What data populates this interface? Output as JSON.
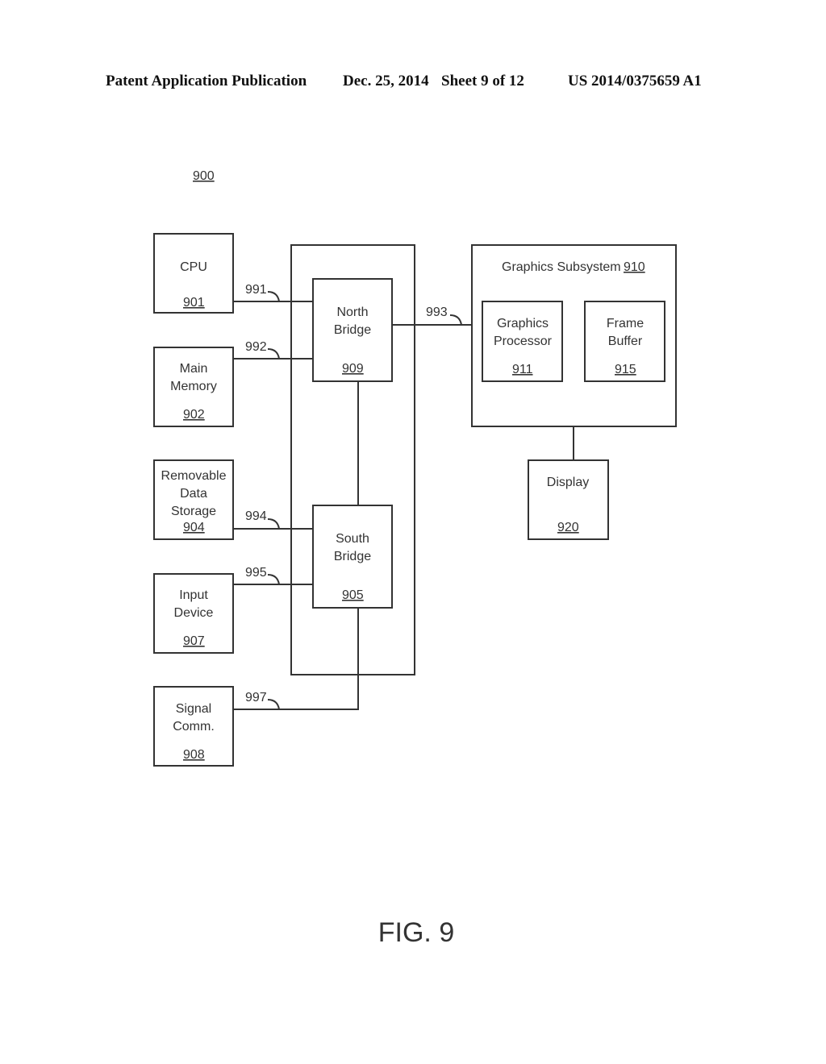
{
  "header": {
    "publication": "Patent Application Publication",
    "date": "Dec. 25, 2014",
    "sheet": "Sheet 9 of 12",
    "number": "US 2014/0375659 A1"
  },
  "diagram": {
    "ref": "900",
    "figure_label": "FIG. 9",
    "blocks": {
      "cpu": {
        "lines": [
          "CPU"
        ],
        "ref": "901"
      },
      "main_memory": {
        "lines": [
          "Main",
          "Memory"
        ],
        "ref": "902"
      },
      "removable_storage": {
        "lines": [
          "Removable",
          "Data",
          "Storage"
        ],
        "ref": "904"
      },
      "input_device": {
        "lines": [
          "Input",
          "Device"
        ],
        "ref": "907"
      },
      "signal_comm": {
        "lines": [
          "Signal",
          "Comm."
        ],
        "ref": "908"
      },
      "north_bridge": {
        "lines": [
          "North",
          "Bridge"
        ],
        "ref": "909"
      },
      "south_bridge": {
        "lines": [
          "South",
          "Bridge"
        ],
        "ref": "905"
      },
      "graphics_subsystem": {
        "label": "Graphics Subsystem",
        "ref": "910"
      },
      "graphics_processor": {
        "lines": [
          "Graphics",
          "Processor"
        ],
        "ref": "911"
      },
      "frame_buffer": {
        "lines": [
          "Frame",
          "Buffer"
        ],
        "ref": "915"
      },
      "display": {
        "lines": [
          "Display"
        ],
        "ref": "920"
      }
    },
    "buses": {
      "b991": "991",
      "b992": "992",
      "b993": "993",
      "b994": "994",
      "b995": "995",
      "b997": "997"
    }
  }
}
